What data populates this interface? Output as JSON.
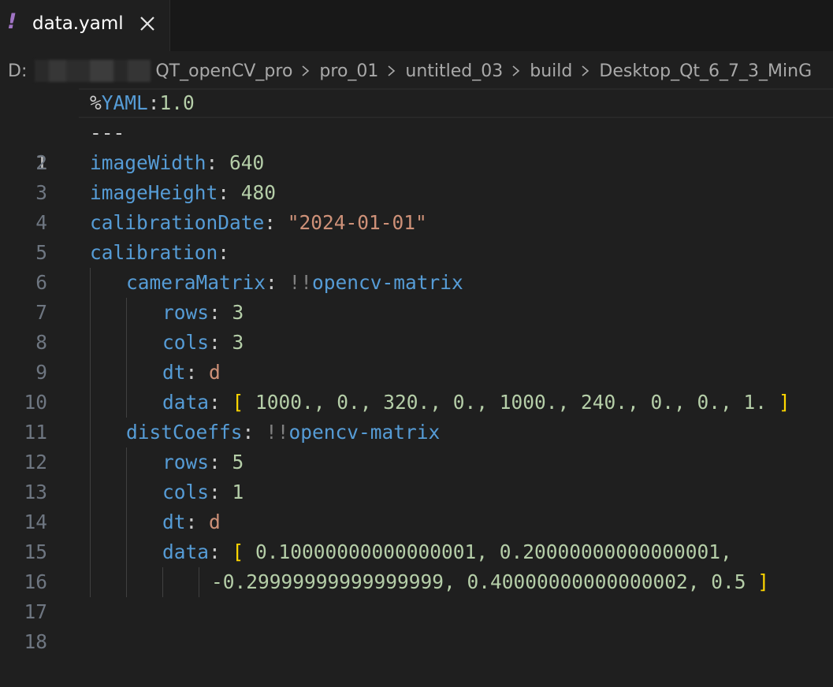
{
  "tab": {
    "icon": "yaml-exclamation-icon",
    "bang": "!",
    "title": "data.yaml"
  },
  "breadcrumb": {
    "drive": "D:",
    "items": [
      "QT_openCV_pro",
      "pro_01",
      "untitled_03",
      "build",
      "Desktop_Qt_6_7_3_MinG"
    ]
  },
  "editor": {
    "line_numbers": [
      "1",
      "2",
      "3",
      "4",
      "5",
      "6",
      "7",
      "8",
      "9",
      "10",
      "11",
      "12",
      "13",
      "14",
      "15",
      "16",
      "17",
      "18"
    ],
    "active_line": "1",
    "lines": {
      "l1": {
        "pct": "%",
        "key": "YAML",
        "colon": ":",
        "val": "1.0"
      },
      "l2": {
        "text": "---"
      },
      "l3": {
        "key": "imageWidth",
        "colon": ": ",
        "val": "640"
      },
      "l4": {
        "key": "imageHeight",
        "colon": ": ",
        "val": "480"
      },
      "l5": {
        "key": "calibrationDate",
        "colon": ": ",
        "val": "\"2024-01-01\""
      },
      "l6": {
        "key": "calibration",
        "colon": ":"
      },
      "l7": {
        "key": "cameraMatrix",
        "colon": ": ",
        "tag": "!!",
        "val": "opencv-matrix"
      },
      "l8": {
        "key": "rows",
        "colon": ": ",
        "val": "3"
      },
      "l9": {
        "key": "cols",
        "colon": ": ",
        "val": "3"
      },
      "l10": {
        "key": "dt",
        "colon": ": ",
        "val": "d"
      },
      "l11": {
        "key": "data",
        "colon": ": ",
        "open": "[",
        "val": " 1000., 0., 320., 0., 1000., 240., 0., 0., 1. ",
        "close": "]"
      },
      "l12": {
        "key": "distCoeffs",
        "colon": ": ",
        "tag": "!!",
        "val": "opencv-matrix"
      },
      "l13": {
        "key": "rows",
        "colon": ": ",
        "val": "5"
      },
      "l14": {
        "key": "cols",
        "colon": ": ",
        "val": "1"
      },
      "l15": {
        "key": "dt",
        "colon": ": ",
        "val": "d"
      },
      "l16": {
        "key": "data",
        "colon": ": ",
        "open": "[",
        "val": " 0.10000000000000001, 0.20000000000000001,"
      },
      "l17": {
        "val": "-0.29999999999999999, 0.40000000000000002, 0.5 ",
        "close": "]"
      }
    }
  },
  "colors": {
    "background": "#1f1f1f",
    "tab_bar": "#181818",
    "key": "#569cd6",
    "number": "#b5cea8",
    "string": "#ce9178",
    "bracket": "#ffd700",
    "yaml_icon": "#a074c4"
  }
}
